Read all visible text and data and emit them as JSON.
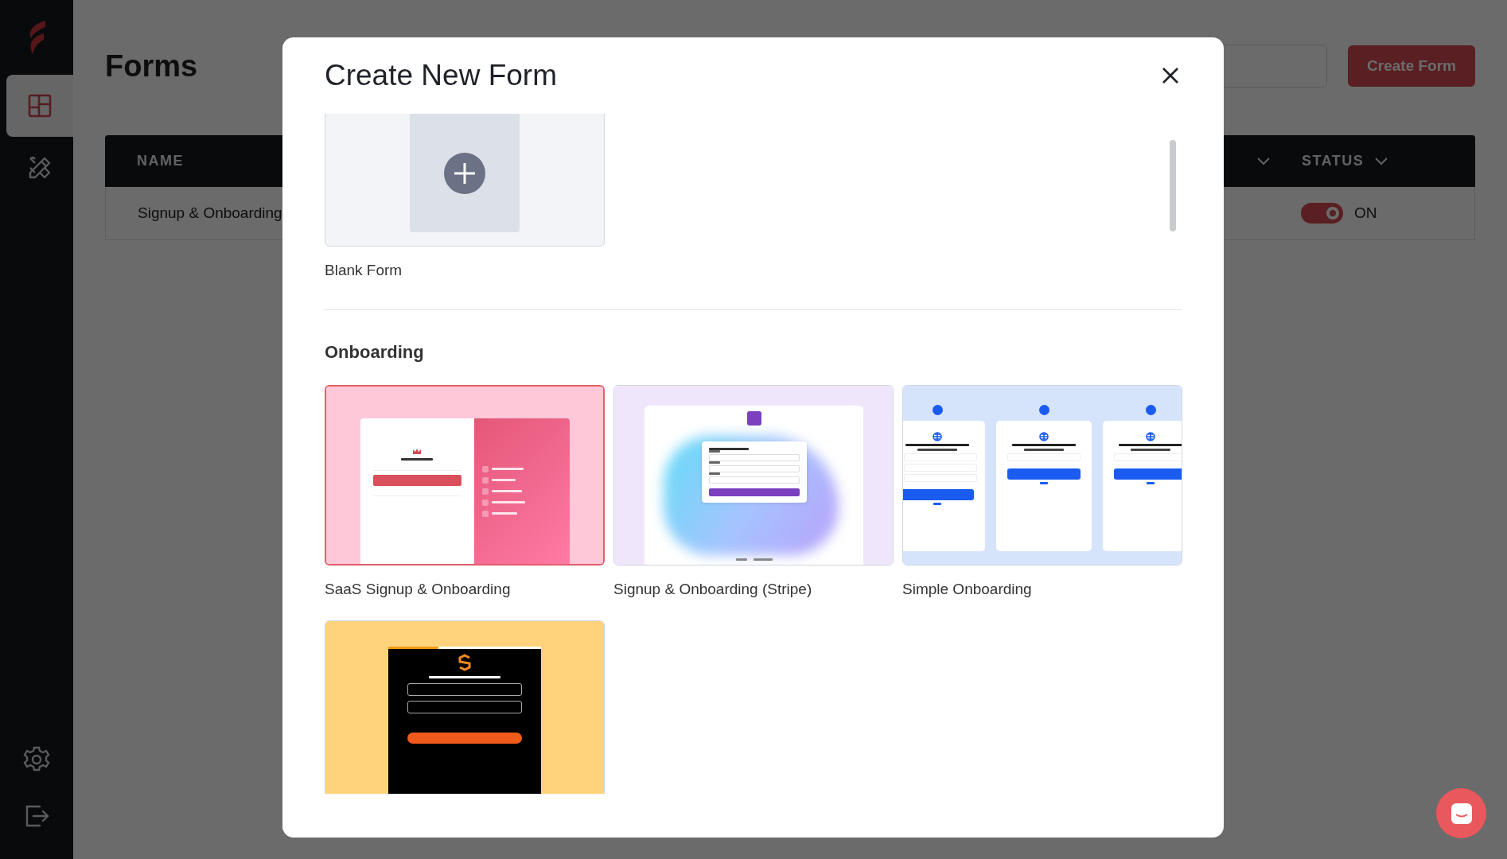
{
  "sidebar": {
    "nav": [
      {
        "selected": true
      },
      {
        "selected": false
      }
    ]
  },
  "page": {
    "title": "Forms",
    "create_button": "Create Form",
    "table": {
      "columns": [
        {
          "label": "NAME"
        },
        {
          "label": "STATUS"
        }
      ],
      "rows": [
        {
          "name": "Signup & Onboarding",
          "status": {
            "on": true,
            "label": "ON"
          }
        }
      ]
    }
  },
  "modal": {
    "title": "Create New Form",
    "blank": {
      "label": "Blank Form"
    },
    "sections": [
      {
        "title": "Onboarding",
        "templates": [
          {
            "kind": "saas",
            "label": "SaaS Signup & Onboarding",
            "selected": true
          },
          {
            "kind": "stripe",
            "label": "Signup & Onboarding (Stripe)",
            "selected": false
          },
          {
            "kind": "steps",
            "label": "Simple Onboarding",
            "selected": false
          },
          {
            "kind": "legal",
            "selected": false
          }
        ]
      }
    ]
  }
}
